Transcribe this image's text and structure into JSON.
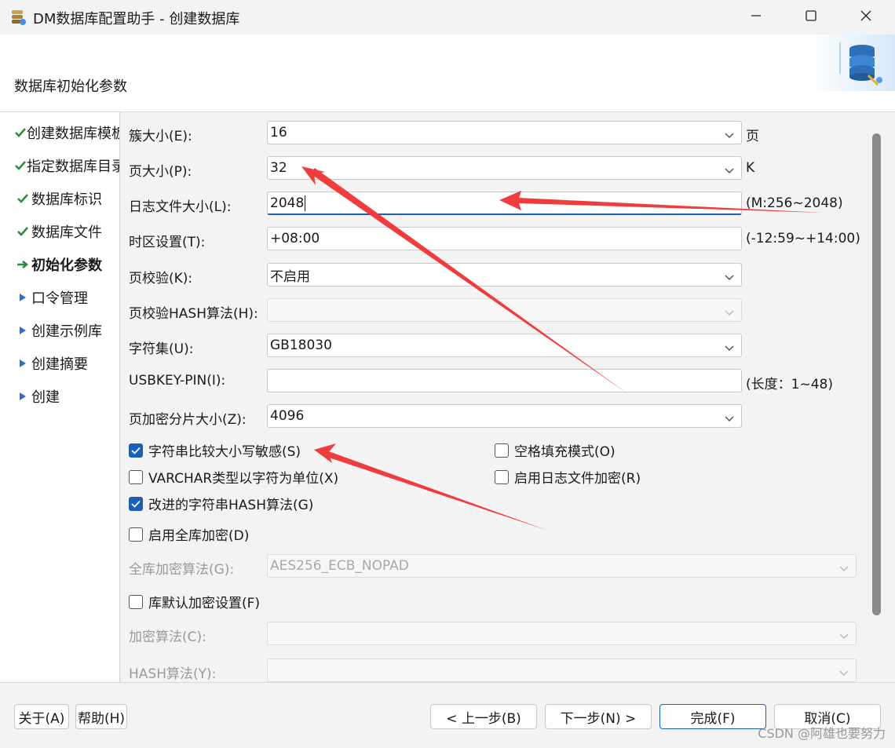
{
  "window": {
    "title": "DM数据库配置助手 - 创建数据库",
    "minimize_icon": "minimize-icon",
    "maximize_icon": "maximize-icon",
    "close_icon": "close-icon"
  },
  "header": {
    "title": "数据库初始化参数",
    "logo_icon": "database-gear-icon"
  },
  "nav": {
    "items": [
      {
        "label": "创建数据库模板",
        "icon": "check-icon",
        "state": "done"
      },
      {
        "label": "指定数据库目录",
        "icon": "check-icon",
        "state": "done"
      },
      {
        "label": "数据库标识",
        "icon": "check-icon",
        "state": "done"
      },
      {
        "label": "数据库文件",
        "icon": "check-icon",
        "state": "done"
      },
      {
        "label": "初始化参数",
        "icon": "arrow-right-icon",
        "state": "current"
      },
      {
        "label": "口令管理",
        "icon": "triangle-right-icon",
        "state": "pending"
      },
      {
        "label": "创建示例库",
        "icon": "triangle-right-icon",
        "state": "pending"
      },
      {
        "label": "创建摘要",
        "icon": "triangle-right-icon",
        "state": "pending"
      },
      {
        "label": "创建",
        "icon": "triangle-right-icon",
        "state": "pending"
      }
    ]
  },
  "form": {
    "cluster_size": {
      "label": "簇大小(E):",
      "value": "16",
      "unit": "页"
    },
    "page_size": {
      "label": "页大小(P):",
      "value": "32",
      "unit": "K"
    },
    "log_size": {
      "label": "日志文件大小(L):",
      "value": "2048",
      "unit": "(M:256~2048)"
    },
    "timezone": {
      "label": "时区设置(T):",
      "value": "+08:00",
      "unit": "(-12:59~+14:00)"
    },
    "page_check": {
      "label": "页校验(K):",
      "value": "不启用"
    },
    "page_check_hash": {
      "label": "页校验HASH算法(H):",
      "value": ""
    },
    "charset": {
      "label": "字符集(U):",
      "value": "GB18030"
    },
    "usbkey_pin": {
      "label": "USBKEY-PIN(I):",
      "value": "",
      "unit": "(长度：1~48)"
    },
    "page_enc_slice": {
      "label": "页加密分片大小(Z):",
      "value": "4096"
    },
    "case_sensitive": {
      "label": "字符串比较大小写敏感(S)",
      "checked": true
    },
    "blank_pad": {
      "label": "空格填充模式(O)",
      "checked": false
    },
    "varchar_char_unit": {
      "label": "VARCHAR类型以字符为单位(X)",
      "checked": false
    },
    "log_encrypt": {
      "label": "启用日志文件加密(R)",
      "checked": false
    },
    "improved_hash": {
      "label": "改进的字符串HASH算法(G)",
      "checked": true
    },
    "full_db_encrypt": {
      "label": "启用全库加密(D)",
      "checked": false
    },
    "full_enc_algo": {
      "label": "全库加密算法(G):",
      "value": "AES256_ECB_NOPAD"
    },
    "default_enc_setting": {
      "label": "库默认加密设置(F)",
      "checked": false
    },
    "enc_algo": {
      "label": "加密算法(C):",
      "value": ""
    },
    "hash_algo": {
      "label": "HASH算法(Y):",
      "value": ""
    }
  },
  "footer": {
    "about": "关于(A)",
    "help": "帮助(H)",
    "prev": "< 上一步(B)",
    "next": "下一步(N) >",
    "finish": "完成(F)",
    "cancel": "取消(C)",
    "watermark": "CSDN @阿雄也要努力"
  },
  "colors": {
    "accent": "#1a5fb4",
    "check_green": "#2e8b3e",
    "annotation_red": "#f03c3c"
  }
}
